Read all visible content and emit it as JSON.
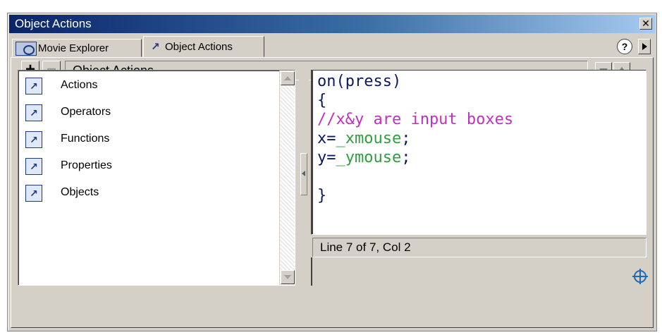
{
  "window": {
    "title": "Object Actions",
    "close_glyph": "✕"
  },
  "tabs": [
    {
      "label": "Movie Explorer",
      "icon": "movie-explorer-icon",
      "active": false
    },
    {
      "label": "Object Actions",
      "icon": "action-arrow-icon",
      "active": true
    }
  ],
  "header_buttons": {
    "help_glyph": "?",
    "menu_icon": "panel-menu-arrow-icon"
  },
  "toolbar": {
    "add_glyph": "+",
    "remove_glyph": "−",
    "title": "Object Actions"
  },
  "toolbox": {
    "items": [
      {
        "label": "Actions",
        "icon": "book-arrow-icon"
      },
      {
        "label": "Operators",
        "icon": "book-arrow-icon"
      },
      {
        "label": "Functions",
        "icon": "book-arrow-icon"
      },
      {
        "label": "Properties",
        "icon": "book-arrow-icon"
      },
      {
        "label": "Objects",
        "icon": "book-arrow-icon"
      }
    ],
    "item_glyph": "↗"
  },
  "code": {
    "line1": "on(press)",
    "line2": "{",
    "line3": "//x&y are input boxes",
    "line4_var": "x=",
    "line4_val": "_xmouse",
    "line4_end": ";",
    "line5_var": "y=",
    "line5_val": "_ymouse",
    "line5_end": ";",
    "line7": "}"
  },
  "status": {
    "position": "Line 7 of 7, Col 2"
  },
  "colors": {
    "title_start": "#0a246a",
    "code_keyword": "#0a1a5c",
    "code_property": "#2e9e3e",
    "code_comment": "#c030c0"
  }
}
